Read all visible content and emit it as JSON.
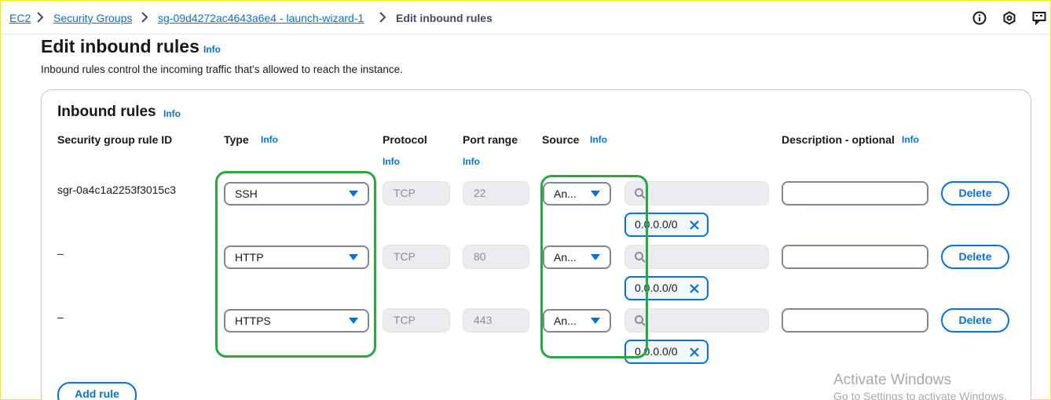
{
  "breadcrumb": {
    "items": [
      "EC2",
      "Security Groups",
      "sg-09d4272ac4643a6e4 - launch-wizard-1"
    ],
    "current": "Edit inbound rules"
  },
  "header_icons": [
    "info-circle-icon",
    "hexagon-settings-icon",
    "feedback-icon"
  ],
  "page": {
    "title": "Edit inbound rules",
    "title_info": "Info",
    "description": "Inbound rules control the incoming traffic that's allowed to reach the instance."
  },
  "panel": {
    "title": "Inbound rules",
    "title_info": "Info",
    "columns": {
      "rule_id": "Security group rule ID",
      "type": "Type",
      "type_info": "Info",
      "protocol": "Protocol",
      "protocol_info": "Info",
      "port_range": "Port range",
      "port_range_info": "Info",
      "source": "Source",
      "source_info": "Info",
      "description": "Description - optional",
      "description_info": "Info"
    },
    "rules": [
      {
        "rule_id": "sgr-0a4c1a2253f3015c3",
        "type": "SSH",
        "protocol": "TCP",
        "port": "22",
        "source_type": "An...",
        "cidr": "0.0.0.0/0",
        "description": "",
        "delete_label": "Delete"
      },
      {
        "rule_id": "–",
        "type": "HTTP",
        "protocol": "TCP",
        "port": "80",
        "source_type": "An...",
        "cidr": "0.0.0.0/0",
        "description": "",
        "delete_label": "Delete"
      },
      {
        "rule_id": "–",
        "type": "HTTPS",
        "protocol": "TCP",
        "port": "443",
        "source_type": "An...",
        "cidr": "0.0.0.0/0",
        "description": "",
        "delete_label": "Delete"
      }
    ],
    "add_rule_label": "Add rule"
  },
  "watermark": {
    "line1": "Activate Windows",
    "line2": "Go to Settings to activate Windows."
  },
  "colors": {
    "accent": "#0972d3",
    "highlight": "#27a844"
  }
}
